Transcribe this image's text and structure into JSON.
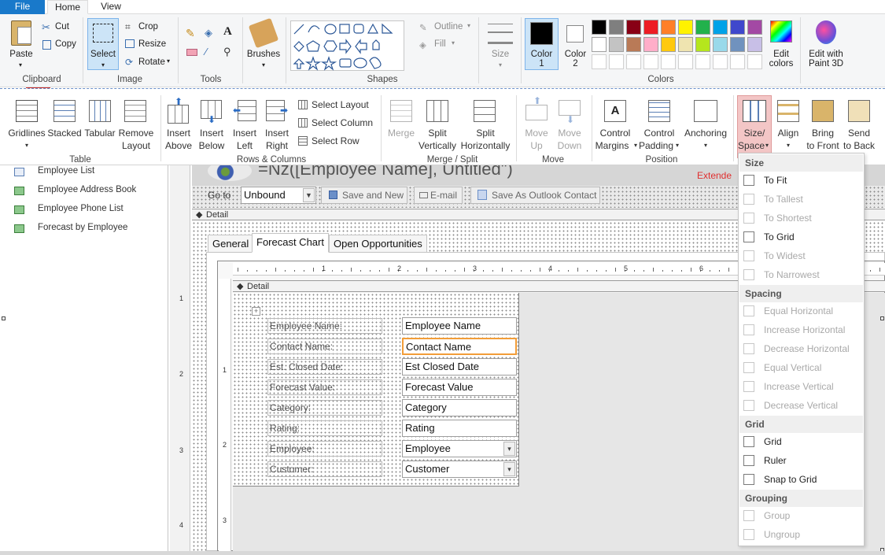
{
  "paint": {
    "tabs": [
      "File",
      "Home",
      "View"
    ],
    "clipboard": {
      "paste": "Paste",
      "cut": "Cut",
      "copy": "Copy",
      "label": "Clipboard"
    },
    "image": {
      "select": "Select",
      "crop": "Crop",
      "resize": "Resize",
      "rotate": "Rotate",
      "label": "Image"
    },
    "tools": {
      "label": "Tools"
    },
    "brushes": "Brushes",
    "shapes": {
      "outline": "Outline",
      "fill": "Fill",
      "label": "Shapes"
    },
    "size": "Size",
    "color1": [
      "Color",
      "1"
    ],
    "color2": [
      "Color",
      "2"
    ],
    "colors_label": "Colors",
    "edit_colors": [
      "Edit",
      "colors"
    ],
    "edit_paint3d": [
      "Edit with",
      "Paint 3D"
    ],
    "palette_row1": [
      "#000000",
      "#7f7f7f",
      "#880015",
      "#ed1c24",
      "#ff7f27",
      "#fff200",
      "#22b14c",
      "#00a2e8",
      "#3f48cc",
      "#a349a4"
    ],
    "palette_row2": [
      "#ffffff",
      "#c3c3c3",
      "#b97a57",
      "#ffaec9",
      "#ffc90e",
      "#efe4b0",
      "#b5e61d",
      "#99d9ea",
      "#7092be",
      "#c8bfe7"
    ]
  },
  "access": {
    "table": {
      "gridlines": "Gridlines",
      "stacked": "Stacked",
      "tabular": "Tabular",
      "remove": [
        "Remove",
        "Layout"
      ],
      "label": "Table"
    },
    "rows": {
      "insert_above": [
        "Insert",
        "Above"
      ],
      "insert_below": [
        "Insert",
        "Below"
      ],
      "insert_left": [
        "Insert",
        "Left"
      ],
      "insert_right": [
        "Insert",
        "Right"
      ],
      "label": "Rows & Columns"
    },
    "select": {
      "layout": "Select Layout",
      "column": "Select Column",
      "row": "Select Row"
    },
    "merge": {
      "merge": "Merge",
      "split_v": [
        "Split",
        "Vertically"
      ],
      "split_h": [
        "Split",
        "Horizontally"
      ],
      "label": "Merge / Split"
    },
    "move": {
      "up": [
        "Move",
        "Up"
      ],
      "down": [
        "Move",
        "Down"
      ],
      "label": "Move"
    },
    "position": {
      "margins": [
        "Control",
        "Margins"
      ],
      "padding": [
        "Control",
        "Padding"
      ],
      "anchoring": "Anchoring",
      "label": "Position"
    },
    "size_space": [
      "Size/",
      "Space"
    ],
    "align": "Align",
    "bring_front": [
      "Bring",
      "to Front"
    ],
    "send_back": [
      "Send",
      "to Back"
    ]
  },
  "nav": {
    "items": [
      "Employee List",
      "Employee Address Book",
      "Employee Phone List",
      "Forecast by Employee"
    ]
  },
  "form": {
    "header_expr": "=Nz([Employee Name], Untitled\")",
    "header_extra": "Extende",
    "goto": "Go to",
    "goto_value": "Unbound",
    "save_new": "Save and New",
    "email": "E-mail",
    "save_outlook": "Save As Outlook Contact",
    "detail": "Detail",
    "tabs": [
      "General",
      "Forecast Chart",
      "Open Opportunities"
    ],
    "sub_detail": "Detail",
    "ruler_nums": [
      "1",
      "2",
      "3",
      "4",
      "5",
      "6"
    ],
    "left_nums": [
      "1",
      "2",
      "3",
      "4"
    ],
    "inner_nums": [
      "1",
      "2",
      "3"
    ],
    "fields": [
      {
        "label": "Employee Name:",
        "value": "Employee Name",
        "type": "text"
      },
      {
        "label": "Contact Name:",
        "value": "Contact Name",
        "type": "text"
      },
      {
        "label": "Est. Closed Date:",
        "value": "Est Closed Date",
        "type": "text"
      },
      {
        "label": "Forecast Value:",
        "value": "Forecast Value",
        "type": "text"
      },
      {
        "label": "Category:",
        "value": "Category",
        "type": "text"
      },
      {
        "label": "Rating:",
        "value": "Rating",
        "type": "text"
      },
      {
        "label": "Employee:",
        "value": "Employee",
        "type": "combo"
      },
      {
        "label": "Customer:",
        "value": "Customer",
        "type": "combo"
      }
    ]
  },
  "menu": {
    "size_hdr": "Size",
    "size": [
      {
        "label": "To Fit",
        "enabled": true
      },
      {
        "label": "To Tallest",
        "enabled": false
      },
      {
        "label": "To Shortest",
        "enabled": false
      },
      {
        "label": "To Grid",
        "enabled": true
      },
      {
        "label": "To Widest",
        "enabled": false
      },
      {
        "label": "To Narrowest",
        "enabled": false
      }
    ],
    "spacing_hdr": "Spacing",
    "spacing": [
      {
        "label": "Equal Horizontal",
        "enabled": false
      },
      {
        "label": "Increase Horizontal",
        "enabled": false
      },
      {
        "label": "Decrease Horizontal",
        "enabled": false
      },
      {
        "label": "Equal Vertical",
        "enabled": false
      },
      {
        "label": "Increase Vertical",
        "enabled": false
      },
      {
        "label": "Decrease Vertical",
        "enabled": false
      }
    ],
    "grid_hdr": "Grid",
    "grid": [
      {
        "label": "Grid",
        "enabled": true
      },
      {
        "label": "Ruler",
        "enabled": true
      },
      {
        "label": "Snap to Grid",
        "enabled": true
      }
    ],
    "grouping_hdr": "Grouping",
    "grouping": [
      {
        "label": "Group",
        "enabled": false
      },
      {
        "label": "Ungroup",
        "enabled": false
      }
    ]
  }
}
